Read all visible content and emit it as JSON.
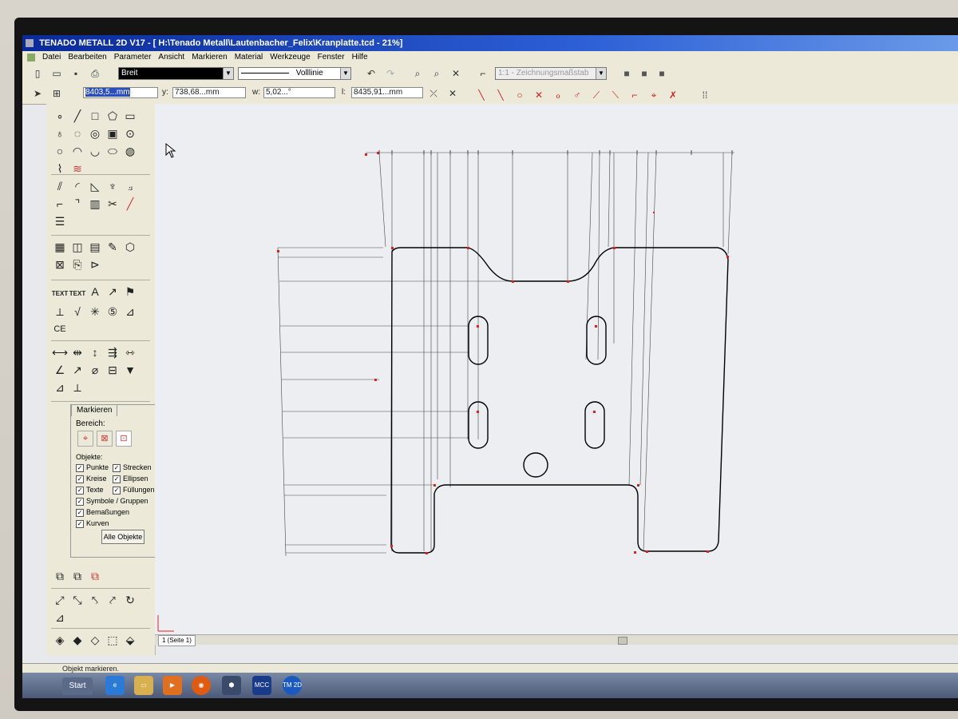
{
  "window": {
    "title": "TENADO METALL 2D V17 - [ H:\\Tenado Metall\\Lautenbacher_Felix\\Kranplatte.tcd - 21%]"
  },
  "menu": [
    "Datei",
    "Bearbeiten",
    "Parameter",
    "Ansicht",
    "Markieren",
    "Material",
    "Werkzeuge",
    "Fenster",
    "Hilfe"
  ],
  "toolbar": {
    "line_width": "Breit",
    "line_type": "Volllinie",
    "scale": "1:1 - Zeichnungsmaßstab"
  },
  "coords": {
    "x_value": "8403,5...mm",
    "y_label": "y:",
    "y_value": "738,68...mm",
    "w_label": "w:",
    "w_value": "5,02...°",
    "l_label": "l:",
    "l_value": "8435,91...mm"
  },
  "palette": {
    "text_tool_1": "TEXT",
    "text_tool_2": "TEXT",
    "text_tool_3": "TEXT",
    "ce_mark": "CE"
  },
  "mark_panel": {
    "tab": "Markieren",
    "bereich": "Bereich:",
    "objekte": "Objekte:",
    "items": [
      "Punkte",
      "Strecken",
      "Kreise",
      "Ellipsen",
      "Texte",
      "Füllungen",
      "Symbole / Gruppen",
      "Bemaßungen",
      "Kurven"
    ],
    "button": "Alle Objekte"
  },
  "page_tab": "1 (Seite 1)",
  "status_text": "Objekt markieren.",
  "taskbar": {
    "start": "Start",
    "tm_icon": "TM 2D",
    "mcc_icon": "MCC"
  }
}
